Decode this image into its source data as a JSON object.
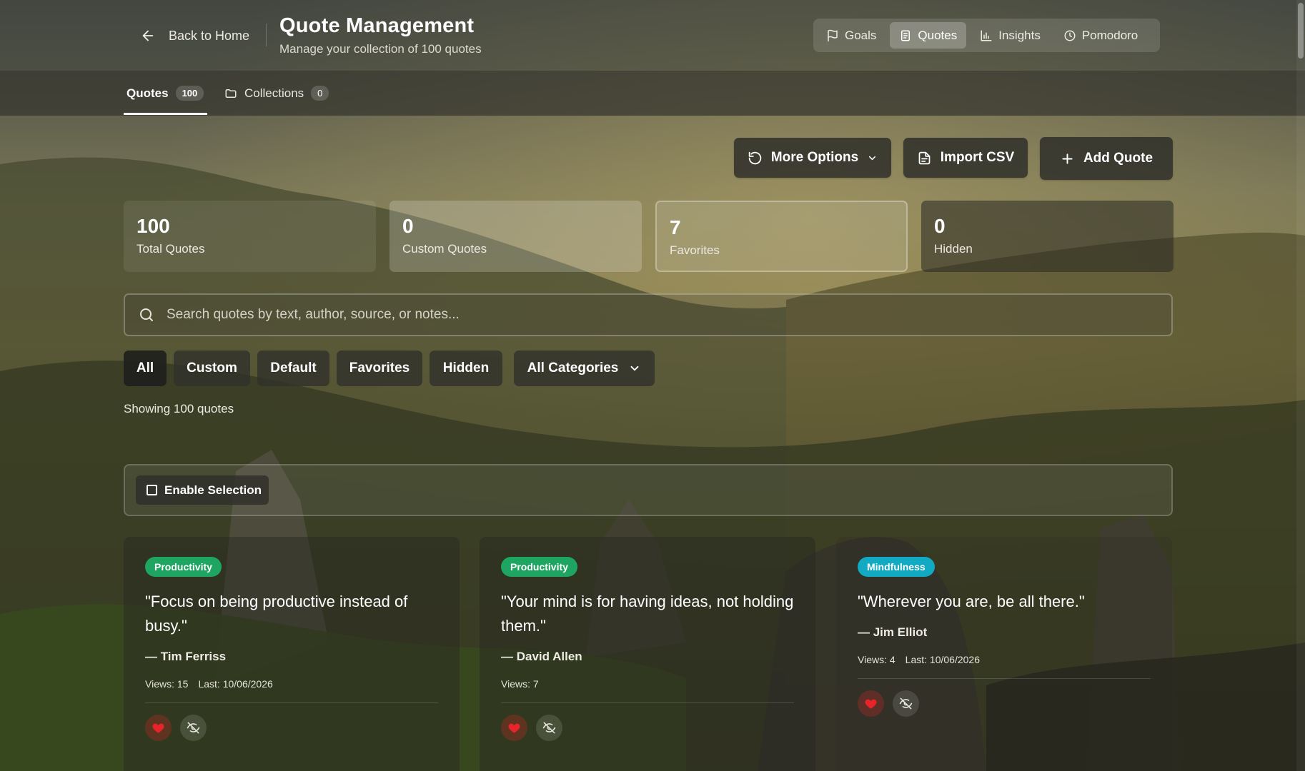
{
  "header": {
    "back_label": "Back to Home",
    "title": "Quote Management",
    "subtitle": "Manage your collection of 100 quotes"
  },
  "nav": {
    "items": [
      {
        "label": "Goals",
        "icon": "flag-icon"
      },
      {
        "label": "Quotes",
        "icon": "document-icon",
        "active": true
      },
      {
        "label": "Insights",
        "icon": "bar-chart-icon"
      },
      {
        "label": "Pomodoro",
        "icon": "clock-icon"
      }
    ]
  },
  "tabs": [
    {
      "label": "Quotes",
      "count": "100",
      "active": true
    },
    {
      "label": "Collections",
      "count": "0",
      "icon": "folder-icon"
    }
  ],
  "actions": {
    "more_options": "More Options",
    "import_csv": "Import CSV",
    "add_quote": "Add Quote"
  },
  "stats": [
    {
      "value": "100",
      "label": "Total Quotes"
    },
    {
      "value": "0",
      "label": "Custom Quotes"
    },
    {
      "value": "7",
      "label": "Favorites"
    },
    {
      "value": "0",
      "label": "Hidden"
    }
  ],
  "search": {
    "placeholder": "Search quotes by text, author, source, or notes...",
    "value": ""
  },
  "filters": {
    "buttons": [
      "All",
      "Custom",
      "Default",
      "Favorites",
      "Hidden"
    ],
    "active": "All",
    "category_select": "All Categories"
  },
  "showing": "Showing 100 quotes",
  "selection": {
    "label": "Enable Selection"
  },
  "quotes": [
    {
      "category": "Productivity",
      "category_color": "#1fa562",
      "text": "\"Focus on being productive instead of busy.\"",
      "author": "— Tim Ferriss",
      "views": "Views: 15",
      "last": "Last: 10/06/2026",
      "favorite": true
    },
    {
      "category": "Productivity",
      "category_color": "#1fa562",
      "text": "\"Your mind is for having ideas, not holding them.\"",
      "author": "— David Allen",
      "views": "Views: 7",
      "last": "",
      "favorite": true
    },
    {
      "category": "Mindfulness",
      "category_color": "#12a9c2",
      "text": "\"Wherever you are, be all there.\"",
      "author": "— Jim Elliot",
      "views": "Views: 4",
      "last": "Last: 10/06/2026",
      "favorite": true
    }
  ],
  "colors": {
    "heart": "#e8242b",
    "productivity_tag": "#1fa562",
    "mindfulness_tag": "#12a9c2"
  }
}
